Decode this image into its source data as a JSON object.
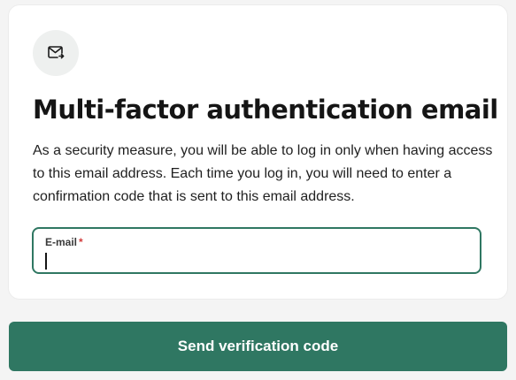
{
  "card": {
    "icon": "mail-forward-icon",
    "title": "Multi-factor authentication email",
    "description": "As a security measure, you will be able to log in only when having access to this email address. Each time you log in, you will need to enter a confirmation code that is sent to this email address."
  },
  "email_field": {
    "label": "E-mail",
    "required_marker": "*",
    "value": "",
    "placeholder": ""
  },
  "actions": {
    "send_label": "Send verification code"
  },
  "colors": {
    "accent": "#2f7762",
    "required": "#d23c3c",
    "icon_background": "#eef0ef",
    "page_background": "#f4f4f4"
  }
}
